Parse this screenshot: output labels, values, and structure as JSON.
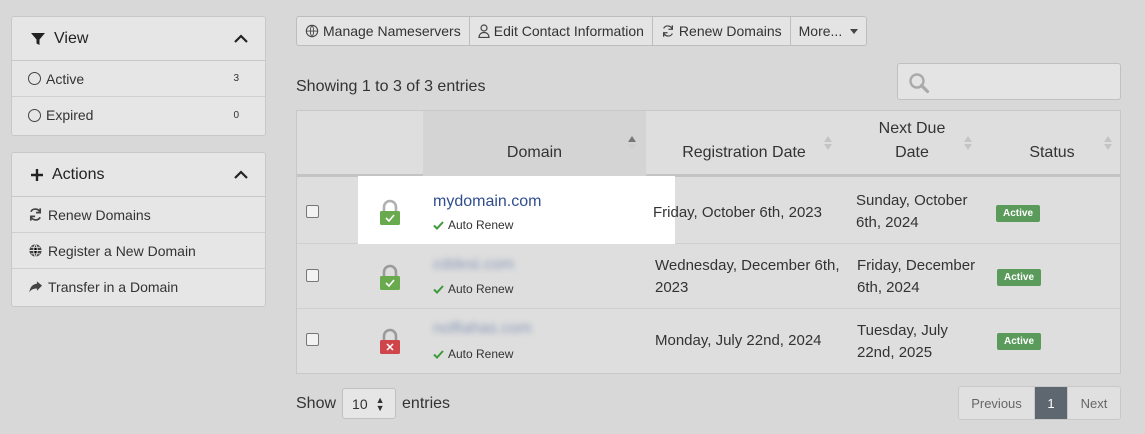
{
  "sidebar": {
    "view": {
      "title": "View",
      "items": [
        {
          "label": "Active",
          "count": "3"
        },
        {
          "label": "Expired",
          "count": "0"
        }
      ]
    },
    "actions": {
      "title": "Actions",
      "items": [
        {
          "label": "Renew Domains",
          "icon": "refresh-icon"
        },
        {
          "label": "Register a New Domain",
          "icon": "globe-icon"
        },
        {
          "label": "Transfer in a Domain",
          "icon": "share-arrow-icon"
        }
      ]
    }
  },
  "toolbar": {
    "manage_ns": "Manage Nameservers",
    "edit_contact": "Edit Contact Information",
    "renew": "Renew Domains",
    "more": "More..."
  },
  "showing": "Showing 1 to 3 of 3 entries",
  "search": {
    "placeholder": ""
  },
  "table": {
    "headers": {
      "domain": "Domain",
      "registration": "Registration Date",
      "next_due_1": "Next Due",
      "next_due_2": "Date",
      "status": "Status"
    },
    "rows": [
      {
        "domain": "mydomain.com",
        "auto_renew": "Auto Renew",
        "registration": "Friday, October 6th, 2023",
        "due_1": "Sunday, October",
        "due_2": "6th, 2024",
        "status": "Active",
        "lock": "green"
      },
      {
        "domain": "cddesi.com",
        "auto_renew": "Auto Renew",
        "registration_1": "Wednesday, December 6th,",
        "registration_2": "2023",
        "due_1": "Friday, December",
        "due_2": "6th, 2024",
        "status": "Active",
        "lock": "green"
      },
      {
        "domain": "nolfiahas.com",
        "auto_renew": "Auto Renew",
        "registration": "Monday, July 22nd, 2024",
        "due_1": "Tuesday, July",
        "due_2": "22nd, 2025",
        "status": "Active",
        "lock": "red"
      }
    ]
  },
  "footer": {
    "show": "Show",
    "per_page": "10",
    "entries": "entries",
    "previous": "Previous",
    "page": "1",
    "next": "Next"
  },
  "colors": {
    "link": "#2f4d8f",
    "active_badge": "#5a9a5a",
    "lock_green": "#6aaa4e",
    "lock_red": "#d0454a",
    "pager_active": "#5e6670"
  }
}
